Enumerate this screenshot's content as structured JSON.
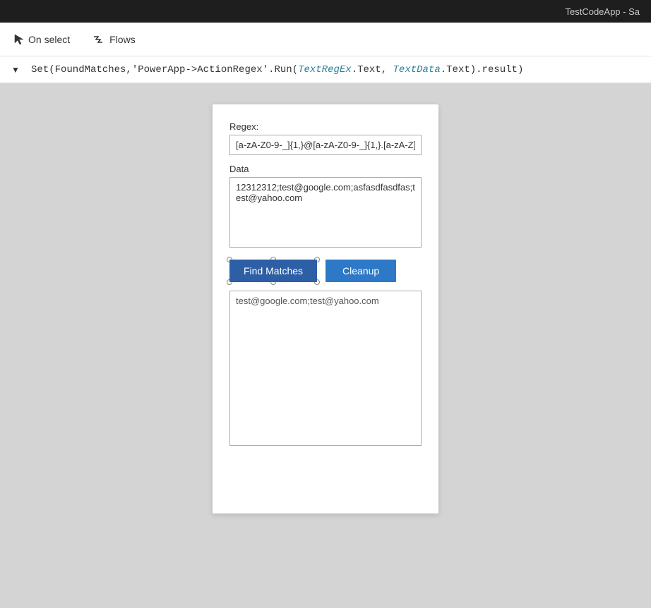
{
  "titleBar": {
    "text": "TestCodeApp - Sa"
  },
  "toolbar": {
    "onSelectLabel": "On select",
    "flowsLabel": "Flows"
  },
  "formulaBar": {
    "dropdownLabel": "▼",
    "content": "Set(FoundMatches,'PowerApp->ActionRegex'.Run(TextRegEx.Text, TextData.Text).result)"
  },
  "app": {
    "regexLabel": "Regex:",
    "regexValue": "[a-zA-Z0-9-_]{1,}@[a-zA-Z0-9-_]{1,}.[a-zA-Z]",
    "dataLabel": "Data",
    "dataValue": "12312312;test@google.com;asfasdfasdfas;test@yahoo.com",
    "findMatchesLabel": "Find Matches",
    "cleanupLabel": "Cleanup",
    "outputValue": "test@google.com;test@yahoo.com"
  }
}
